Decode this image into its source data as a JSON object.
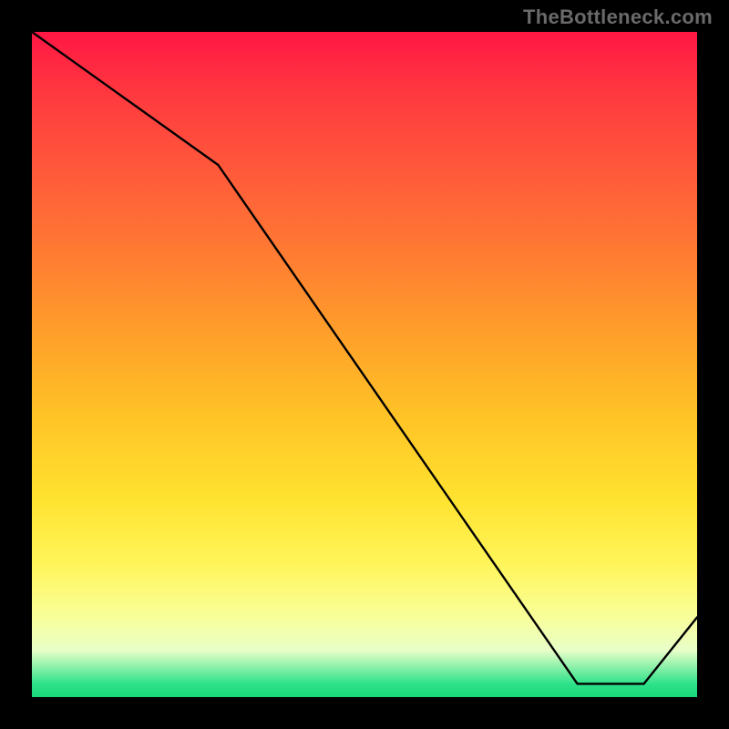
{
  "watermark": "TheBottleneck.com",
  "chart_data": {
    "type": "line",
    "title": "",
    "xlabel": "",
    "ylabel": "",
    "xlim": [
      0,
      100
    ],
    "ylim": [
      0,
      100
    ],
    "x": [
      0,
      28,
      82,
      92,
      100
    ],
    "values": [
      100,
      80,
      2,
      2,
      12
    ],
    "grid": false,
    "legend": false
  },
  "axis_caption": "",
  "colors": {
    "line": "#000000",
    "bg_top": "#ff1744",
    "bg_bottom": "#18d87a"
  }
}
